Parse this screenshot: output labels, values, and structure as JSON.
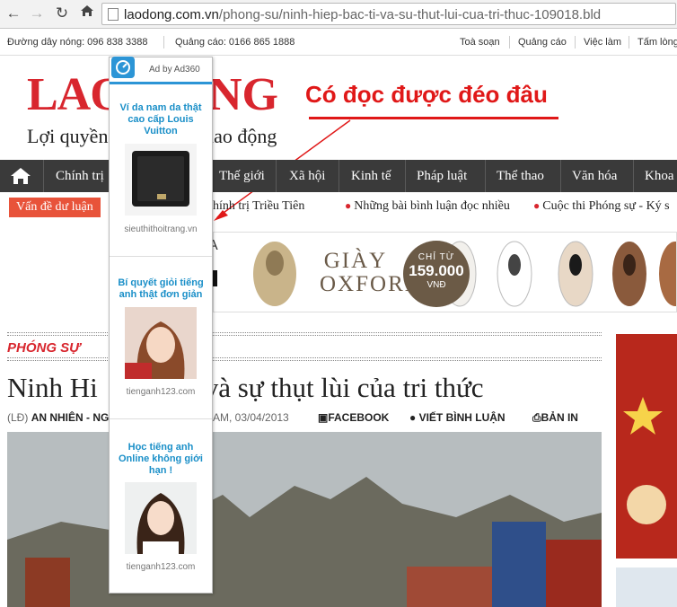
{
  "browser": {
    "url_domain": "laodong.com.vn",
    "url_path": "/phong-su/ninh-hiep-bac-ti-va-su-thut-lui-cua-tri-thuc-109018.bld",
    "back_icon": "arrow-left-icon",
    "forward_icon": "arrow-right-icon",
    "reload_icon": "reload-icon",
    "home_icon": "home-icon"
  },
  "topbar": {
    "hotline": "Đường dây nóng: 096 838 3388",
    "ads": "Quảng cáo: 0166 865 1888",
    "links": [
      "Toà soạn",
      "Quảng cáo",
      "Việc làm",
      "Tấm lòng"
    ]
  },
  "logo": {
    "main": "LAO",
    "tail": "NG",
    "slogan_left": "Lợi quyền",
    "slogan_right": "lao động"
  },
  "annotation": {
    "text": "Có đọc được đéo đâu",
    "color": "#e01818"
  },
  "nav": {
    "items": [
      "Chính trị",
      "Thế giới",
      "Xã hội",
      "Kinh tế",
      "Pháp luật",
      "Thể thao",
      "Văn hóa",
      "Khoa"
    ]
  },
  "subbar": {
    "tag": "Vấn đề dư luận",
    "items": [
      "hính trị Triều Tiên",
      "Những bài bình luận đọc nhiều",
      "Cuộc thi Phóng sự - Ký s"
    ]
  },
  "banner": {
    "left_text": "A",
    "giay_line1": "GIÀY",
    "giay_line2": "OXFORD",
    "price_label": "CHỈ TỪ",
    "price_value": "159.000",
    "price_unit": "VNĐ"
  },
  "article": {
    "section": "PHÓNG SỰ",
    "headline_left": "Ninh Hi",
    "headline_right": "tỉ và sự thụt lùi của tri thức",
    "byline_prefix": "(LĐ)",
    "byline_author": "AN NHIÊN - NG",
    "byline_time": "AM, 03/04/2013",
    "actions": {
      "facebook": "FACEBOOK",
      "comment": "VIẾT BÌNH LUẬN",
      "print": "BẢN IN"
    }
  },
  "ad_panel": {
    "by": "Ad by Ad360",
    "items": [
      {
        "title": "Ví da nam da thật cao cấp Louis Vuitton",
        "site": "sieuthithoitrang.vn"
      },
      {
        "title": "Bí quyết giỏi tiếng anh thật đơn giản",
        "site": "tienganh123.com"
      },
      {
        "title": "Học tiếng anh Online không giới hạn !",
        "site": "tienganh123.com"
      }
    ]
  }
}
